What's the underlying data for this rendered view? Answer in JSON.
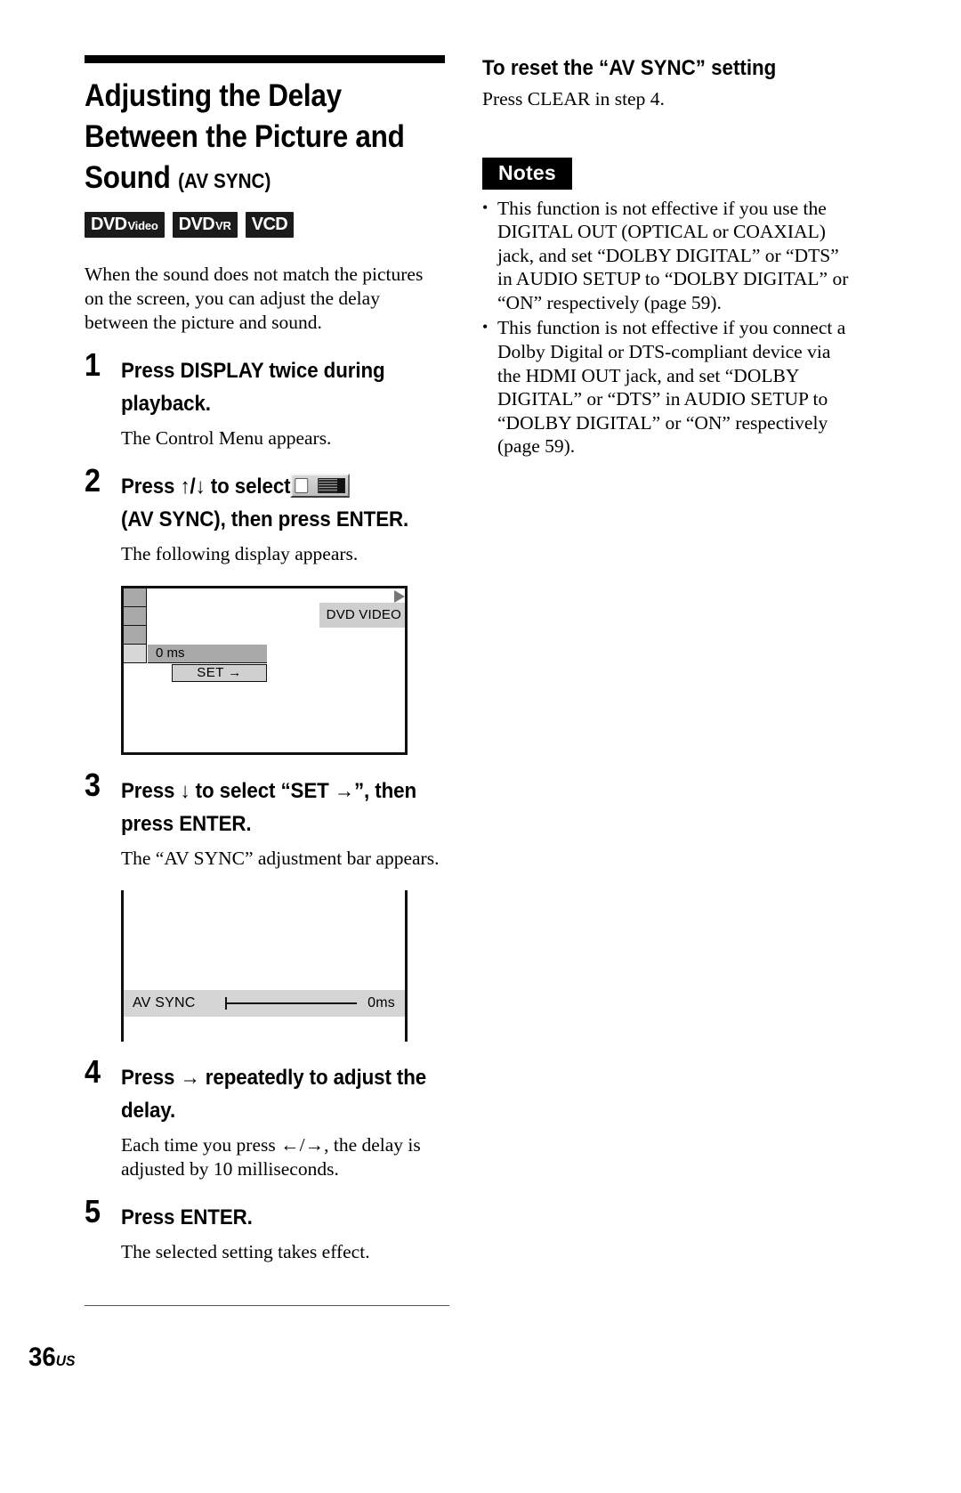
{
  "page": {
    "number": "36",
    "region_suffix": "US"
  },
  "left": {
    "title_line1": "Adjusting the Delay",
    "title_line2": "Between the Picture and",
    "title_line3": "Sound",
    "title_suffix": "(AV SYNC)",
    "badges": [
      {
        "main": "DVD",
        "sup": "Video",
        "name": "dvd-video-badge"
      },
      {
        "main": "DVD",
        "sup": "VR",
        "name": "dvd-vr-badge"
      },
      {
        "main": "VCD",
        "sup": "",
        "name": "vcd-badge"
      }
    ],
    "intro": "When the sound does not match the pictures on the screen, you can adjust the delay between the picture and sound.",
    "steps": [
      {
        "number": "1",
        "title": "Press DISPLAY twice during playback.",
        "desc": "The Control Menu appears."
      },
      {
        "number": "2",
        "title_before_icon": "Press ↑/↓ to select",
        "title_after_icon": "(AV SYNC), then press ENTER.",
        "icon_name": "av-sync-control-menu-icon",
        "desc": "The following display appears."
      },
      {
        "number": "3",
        "title": "Press ↓ to select “SET →”, then press ENTER.",
        "desc": "The “AV SYNC” adjustment bar appears."
      },
      {
        "number": "4",
        "title": "Press → repeatedly to adjust the delay.",
        "desc": "Each time you press ←/→, the delay is adjusted by 10 milliseconds."
      },
      {
        "number": "5",
        "title": "Press ENTER.",
        "desc": "The selected setting takes effect."
      }
    ],
    "screen_control_menu": {
      "value_label": "0 ms",
      "set_label": "SET →",
      "disc_label": "DVD VIDEO"
    },
    "screen_av_sync": {
      "bar_label": "AV SYNC",
      "bar_value": "0ms"
    }
  },
  "right": {
    "heading": "To reset the “AV SYNC” setting",
    "body": "Press CLEAR in step 4.",
    "notes_label": "Notes",
    "notes": [
      "This function is not effective if you use the DIGITAL OUT (OPTICAL or COAXIAL) jack, and set “DOLBY DIGITAL” or “DTS” in AUDIO SETUP to “DOLBY DIGITAL” or “ON” respectively (page 59).",
      "This function is not effective if you connect a Dolby Digital or DTS-compliant device via the HDMI OUT jack, and set “DOLBY DIGITAL” or “DTS” in AUDIO SETUP to “DOLBY DIGITAL” or “ON” respectively (page 59)."
    ]
  }
}
